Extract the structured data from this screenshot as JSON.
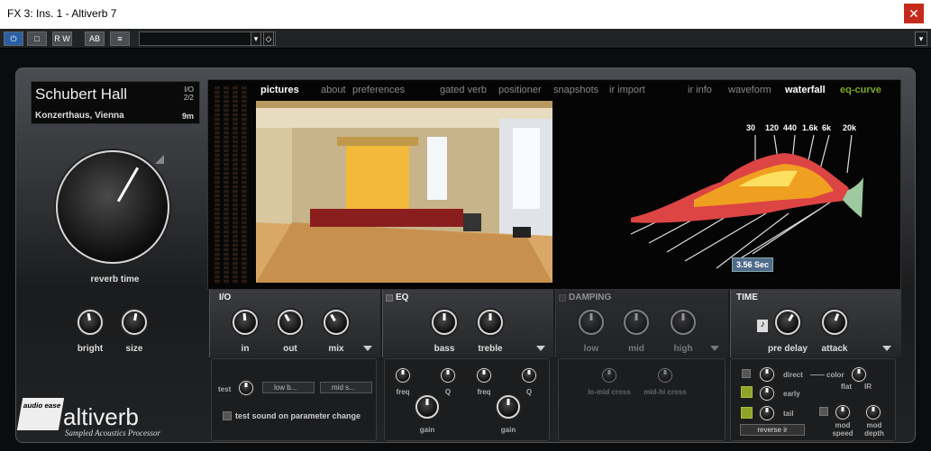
{
  "window": {
    "title": "FX 3: Ins. 1 - Altiverb 7",
    "close_label": "✕"
  },
  "toolbar": {
    "power": "⏻",
    "compare": "□",
    "rw": "R W",
    "ab": "AB",
    "menu": "≡",
    "preset_value": ""
  },
  "lcd": {
    "name": "Schubert Hall",
    "io": "I/O",
    "io_val": "2/2",
    "location": "Konzerthaus, Vienna",
    "size": "9m"
  },
  "main_knob": {
    "label": "reverb time"
  },
  "bottom_left": {
    "bright": "bright",
    "size": "size"
  },
  "tabs": {
    "left": [
      "pictures",
      "about",
      "preferences"
    ],
    "mid": [
      "gated verb",
      "positioner",
      "snapshots",
      "ir import"
    ],
    "right": [
      "ir info",
      "waveform",
      "waterfall",
      "eq-curve"
    ],
    "active": "waterfall",
    "accent": "#7aa82a"
  },
  "waterfall": {
    "freqs": [
      "30",
      "120",
      "440",
      "1.6k",
      "6k",
      "20k"
    ],
    "time": "3.56 Sec"
  },
  "sections": {
    "io": {
      "title": "I/O",
      "knobs": [
        "in",
        "out",
        "mix"
      ]
    },
    "eq": {
      "title": "EQ",
      "knobs": [
        "bass",
        "treble"
      ]
    },
    "damping": {
      "title": "DAMPING",
      "knobs": [
        "low",
        "mid",
        "high"
      ]
    },
    "time": {
      "title": "TIME",
      "knobs": [
        "pre delay",
        "attack"
      ]
    }
  },
  "test_panel": {
    "test": "test",
    "dd1": "low b...",
    "dd2": "mid s...",
    "check": "test sound on parameter change"
  },
  "eq_panel": {
    "freq": "freq",
    "q": "Q",
    "gain": "gain"
  },
  "damp_panel": {
    "lo": "lo-mid cross",
    "hi": "mid-hi cross"
  },
  "time_panel": {
    "direct": "direct",
    "color": "color",
    "flat": "flat",
    "ir": "IR",
    "early": "early",
    "tail": "tail",
    "mod_speed": "mod speed",
    "mod_depth": "mod depth",
    "reverse": "reverse ir"
  },
  "logo": {
    "brand": "altiverb",
    "tag": "Sampled Acoustics Processor",
    "badge": "audio ease"
  }
}
